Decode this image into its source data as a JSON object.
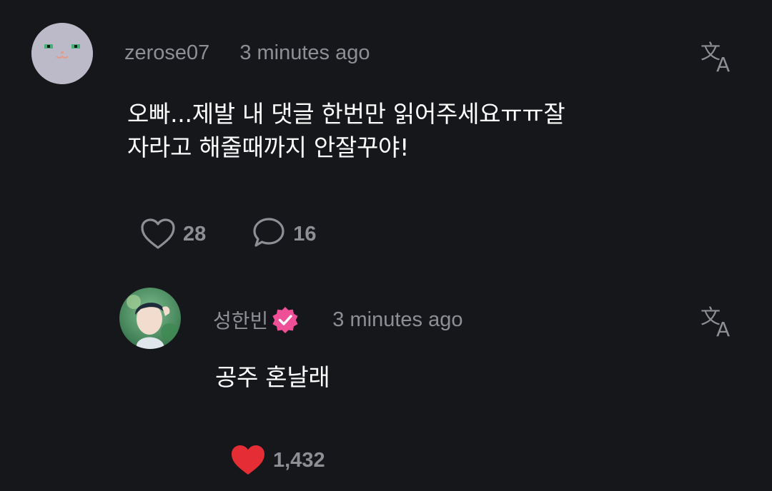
{
  "comment": {
    "username": "zerose07",
    "time": "3 minutes ago",
    "text_line1": "오빠...제발 내 댓글 한번만 읽어주세요ㅠㅠ잘",
    "text_line2": "자라고 해줄때까지 안잘꾸야!",
    "like_count": "28",
    "reply_count": "16",
    "avatar_icon": "cat-face-avatar",
    "translate_icon": "translate-icon"
  },
  "reply": {
    "username": "성한빈",
    "verified": true,
    "verified_color": "#ef4f97",
    "time": "3 minutes ago",
    "text": "공주 혼날래",
    "like_count": "1,432",
    "liked": true,
    "like_color": "#e52d36",
    "avatar_icon": "profile-photo",
    "translate_icon": "translate-icon"
  },
  "colors": {
    "background": "#16171b",
    "muted_text": "#8e8e95",
    "primary_text": "#ffffff"
  }
}
